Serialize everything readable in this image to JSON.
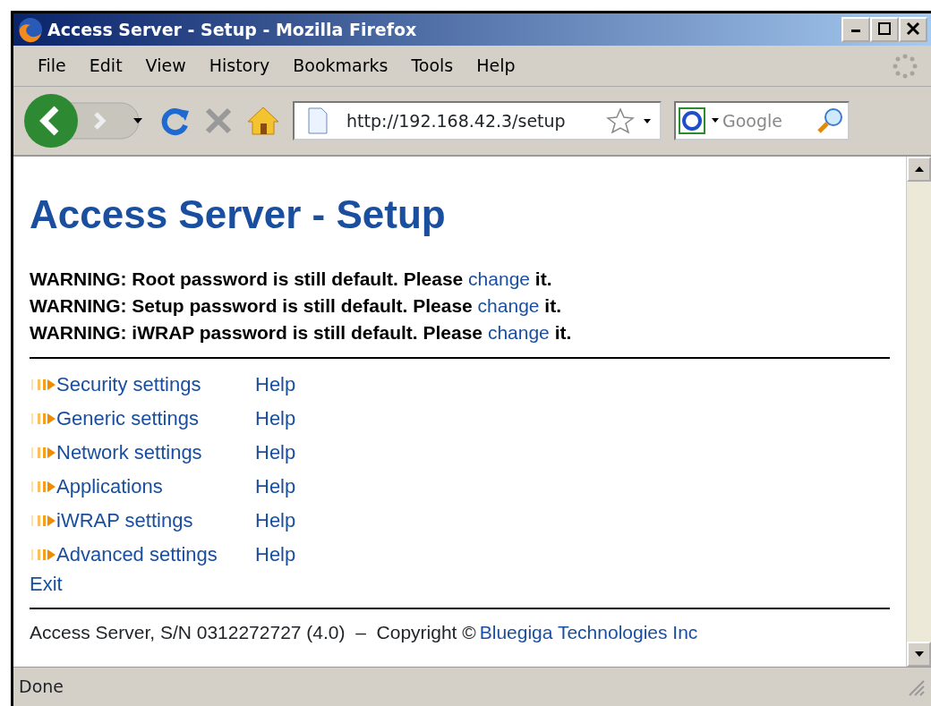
{
  "window": {
    "title": "Access Server - Setup - Mozilla Firefox"
  },
  "menu": [
    "File",
    "Edit",
    "View",
    "History",
    "Bookmarks",
    "Tools",
    "Help"
  ],
  "toolbar": {
    "url": "http://192.168.42.3/setup",
    "search_placeholder": "Google"
  },
  "page": {
    "heading": "Access Server - Setup",
    "warnings": [
      {
        "text": "WARNING: Root password is still default. Please ",
        "link": "change",
        "after": " it."
      },
      {
        "text": "WARNING: Setup password is still default. Please ",
        "link": "change",
        "after": " it."
      },
      {
        "text": "WARNING: iWRAP password is still default. Please ",
        "link": "change",
        "after": " it."
      }
    ],
    "links": [
      {
        "label": "Security settings",
        "help": "Help"
      },
      {
        "label": "Generic settings",
        "help": "Help"
      },
      {
        "label": "Network settings",
        "help": "Help"
      },
      {
        "label": "Applications",
        "help": "Help"
      },
      {
        "label": "iWRAP settings",
        "help": "Help"
      },
      {
        "label": "Advanced settings",
        "help": "Help"
      }
    ],
    "exit": "Exit",
    "footer": {
      "text": "Access Server, S/N 0312272727 (4.0)  –  Copyright ©",
      "link": "Bluegiga Technologies Inc"
    }
  },
  "status_bar": "Done"
}
